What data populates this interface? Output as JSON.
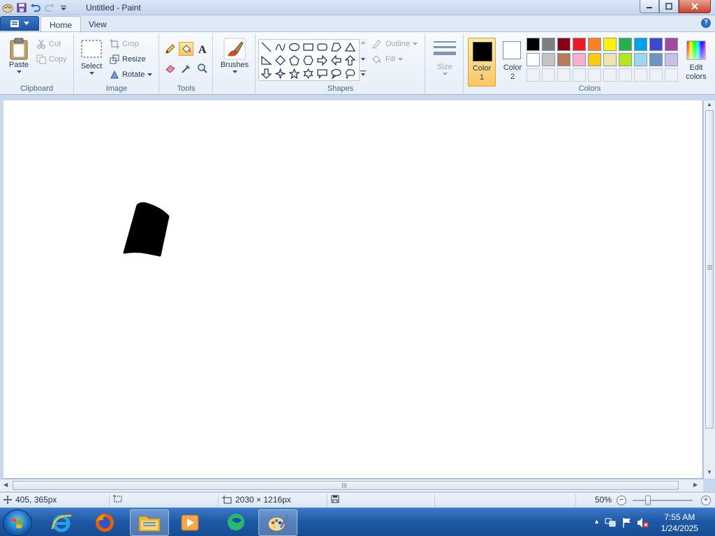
{
  "window": {
    "title": "Untitled - Paint"
  },
  "tabs": {
    "home": "Home",
    "view": "View"
  },
  "ribbon": {
    "clipboard": {
      "group_label": "Clipboard",
      "paste": "Paste",
      "cut": "Cut",
      "copy": "Copy"
    },
    "image": {
      "group_label": "Image",
      "select": "Select",
      "crop": "Crop",
      "resize": "Resize",
      "rotate": "Rotate"
    },
    "tools": {
      "group_label": "Tools"
    },
    "brushes": {
      "label": "Brushes"
    },
    "shapes": {
      "group_label": "Shapes",
      "outline": "Outline",
      "fill": "Fill"
    },
    "size": {
      "label": "Size"
    },
    "colors": {
      "group_label": "Colors",
      "color1_line1": "Color",
      "color1_line2": "1",
      "color2_line1": "Color",
      "color2_line2": "2",
      "edit_line1": "Edit",
      "edit_line2": "colors",
      "color1_value": "#000000",
      "color2_value": "#ffffff",
      "palette_row1": [
        "#000000",
        "#7f7f7f",
        "#880015",
        "#ed1c24",
        "#ff7f27",
        "#fff200",
        "#22b14c",
        "#00a2e8",
        "#3f48cc",
        "#a349a4"
      ],
      "palette_row2": [
        "#ffffff",
        "#c3c3c3",
        "#b97a57",
        "#ffaec9",
        "#ffc90e",
        "#efe4b0",
        "#b5e61d",
        "#99d9ea",
        "#7092be",
        "#c8bfe7"
      ]
    }
  },
  "statusbar": {
    "cursor_pos": "405, 365px",
    "image_size": "2030 × 1216px",
    "zoom": "50%"
  },
  "taskbar": {
    "time": "7:55 AM",
    "date": "1/24/2025",
    "apps": [
      "internet-explorer",
      "firefox",
      "file-explorer",
      "media-player",
      "unknown-app",
      "paint"
    ]
  },
  "canvas": {
    "drawn_shape": "black-filled-quadrilateral"
  }
}
